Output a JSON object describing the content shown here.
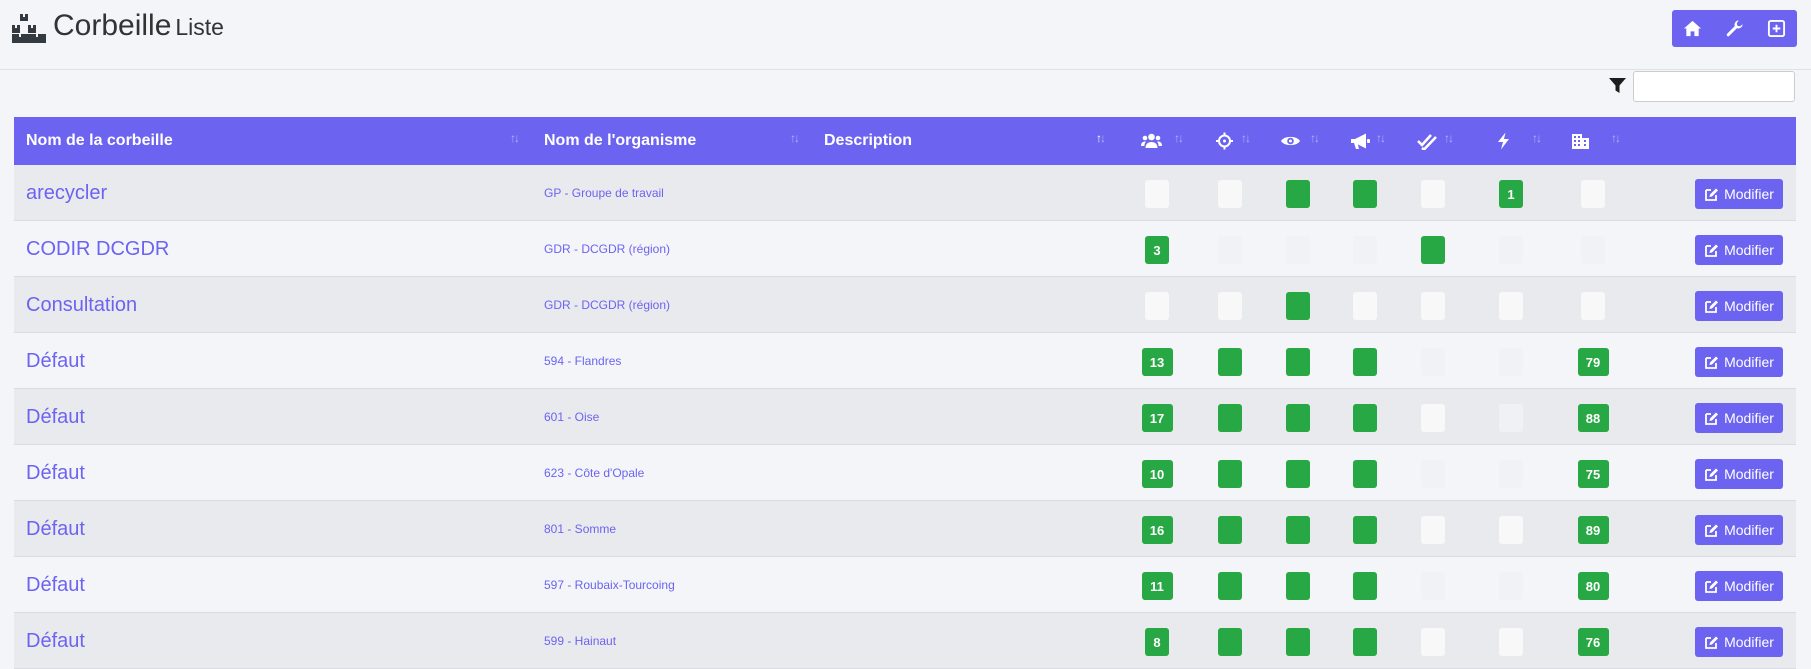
{
  "header": {
    "title": "Corbeille",
    "subtitle": "Liste",
    "icons": [
      "boxes-icon"
    ]
  },
  "toolbar": {
    "buttons": [
      {
        "name": "home-button",
        "icon": "home-icon"
      },
      {
        "name": "settings-button",
        "icon": "wrench-icon"
      },
      {
        "name": "add-button",
        "icon": "plus-square-icon"
      }
    ]
  },
  "filter": {
    "icon": "filter-icon",
    "value": ""
  },
  "table": {
    "columns": [
      {
        "label": "Nom de la corbeille"
      },
      {
        "label": "Nom de l'organisme"
      },
      {
        "label": "Description"
      },
      {
        "icon": "users-icon"
      },
      {
        "icon": "crosshairs-icon"
      },
      {
        "icon": "eye-icon"
      },
      {
        "icon": "bullhorn-icon"
      },
      {
        "icon": "check-double-icon"
      },
      {
        "icon": "bolt-icon"
      },
      {
        "icon": "building-icon"
      }
    ],
    "action_label": "Modifier",
    "colors": {
      "accent": "#6c63f0",
      "green": "#28a745"
    },
    "rows": [
      {
        "name": "arecycler",
        "org": "GP - Groupe de travail",
        "indicators": [
          "",
          "",
          "on",
          "on",
          "",
          "1",
          ""
        ]
      },
      {
        "name": "CODIR DCGDR",
        "org": "GDR - DCGDR (région)",
        "indicators": [
          "3",
          null,
          null,
          null,
          "on",
          null,
          null
        ]
      },
      {
        "name": "Consultation",
        "org": "GDR - DCGDR (région)",
        "indicators": [
          "",
          "",
          "on",
          "",
          "",
          "",
          ""
        ]
      },
      {
        "name": "Défaut",
        "org": "594 - Flandres",
        "indicators": [
          "13",
          "on",
          "on",
          "on",
          null,
          null,
          "79"
        ]
      },
      {
        "name": "Défaut",
        "org": "601 - Oise",
        "indicators": [
          "17",
          "on",
          "on",
          "on",
          "",
          null,
          "88"
        ]
      },
      {
        "name": "Défaut",
        "org": "623 - Côte d'Opale",
        "indicators": [
          "10",
          "on",
          "on",
          "on",
          null,
          null,
          "75"
        ]
      },
      {
        "name": "Défaut",
        "org": "801 - Somme",
        "indicators": [
          "16",
          "on",
          "on",
          "on",
          "",
          "",
          "89"
        ]
      },
      {
        "name": "Défaut",
        "org": "597 - Roubaix-Tourcoing",
        "indicators": [
          "11",
          "on",
          "on",
          "on",
          null,
          null,
          "80"
        ]
      },
      {
        "name": "Défaut",
        "org": "599 - Hainaut",
        "indicators": [
          "8",
          "on",
          "on",
          "on",
          "",
          "",
          "76"
        ]
      }
    ]
  }
}
